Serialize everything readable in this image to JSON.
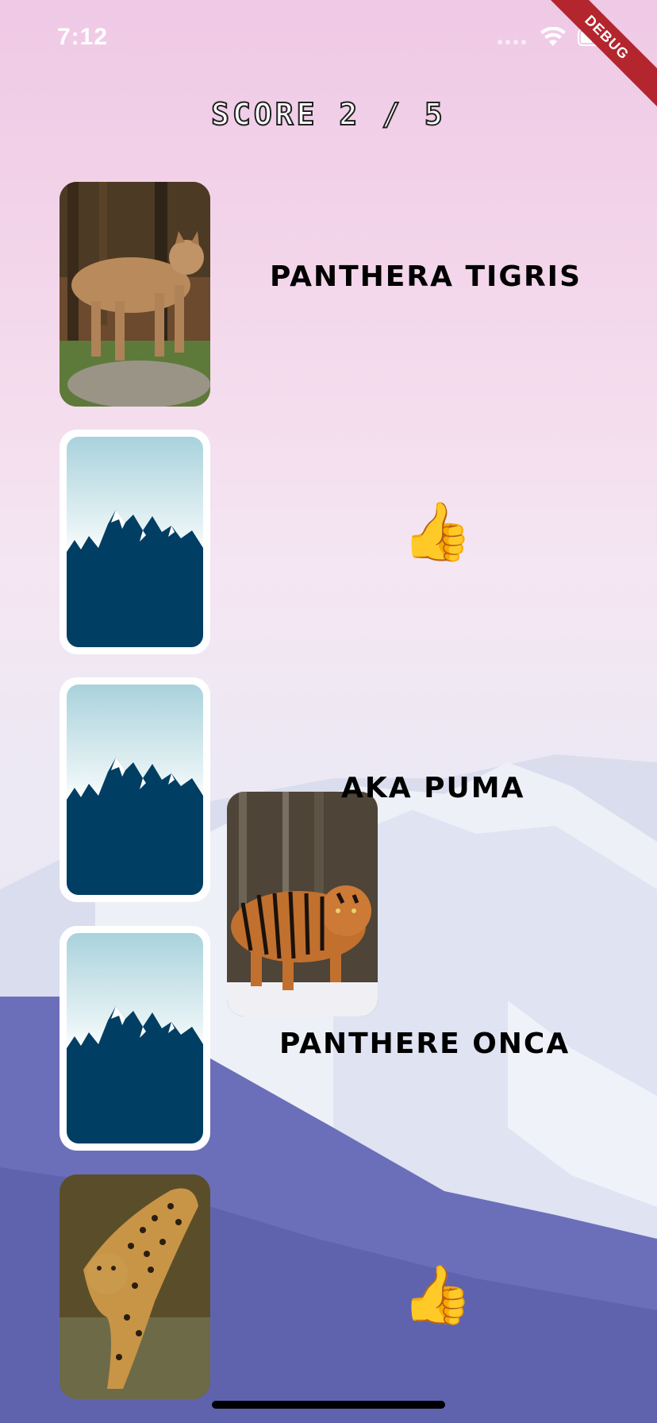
{
  "status_bar": {
    "time": "7:12"
  },
  "debug_banner": "DEBUG",
  "score": "SCORE 2 / 5",
  "cards": [
    {
      "state": "revealed",
      "animal": "puma"
    },
    {
      "state": "hidden",
      "image": "mountain-card-back"
    },
    {
      "state": "hidden",
      "image": "mountain-card-back"
    },
    {
      "state": "hidden",
      "image": "mountain-card-back"
    },
    {
      "state": "revealed",
      "animal": "jaguar"
    }
  ],
  "dragging_card": {
    "animal": "tiger"
  },
  "labels": {
    "l1": "PANTHERA TIGRIS",
    "l2": "AKA PUMA",
    "l3": "PANTHERE ONCA"
  },
  "feedback": [
    "👍",
    "👍"
  ]
}
